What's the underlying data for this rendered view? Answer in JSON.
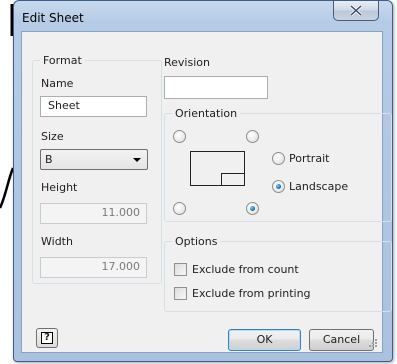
{
  "window": {
    "title": "Edit Sheet"
  },
  "format": {
    "group_title": "Format",
    "name_label": "Name",
    "name_value": "Sheet",
    "size_label": "Size",
    "size_value": "B",
    "height_label": "Height",
    "height_value": "11.000",
    "width_label": "Width",
    "width_value": "17.000"
  },
  "revision": {
    "label": "Revision",
    "value": ""
  },
  "orientation": {
    "group_title": "Orientation",
    "portrait_label": "Portrait",
    "landscape_label": "Landscape",
    "selected": "landscape",
    "corner_selected": "bottom-right"
  },
  "options": {
    "group_title": "Options",
    "exclude_count_label": "Exclude from count",
    "exclude_printing_label": "Exclude from printing"
  },
  "buttons": {
    "ok_label": "OK",
    "cancel_label": "Cancel"
  },
  "colors": {
    "frame": "#b5cbe6",
    "accent": "#1b6fb5"
  },
  "icons": {
    "close": "close-x-icon",
    "help": "help-question-icon"
  }
}
